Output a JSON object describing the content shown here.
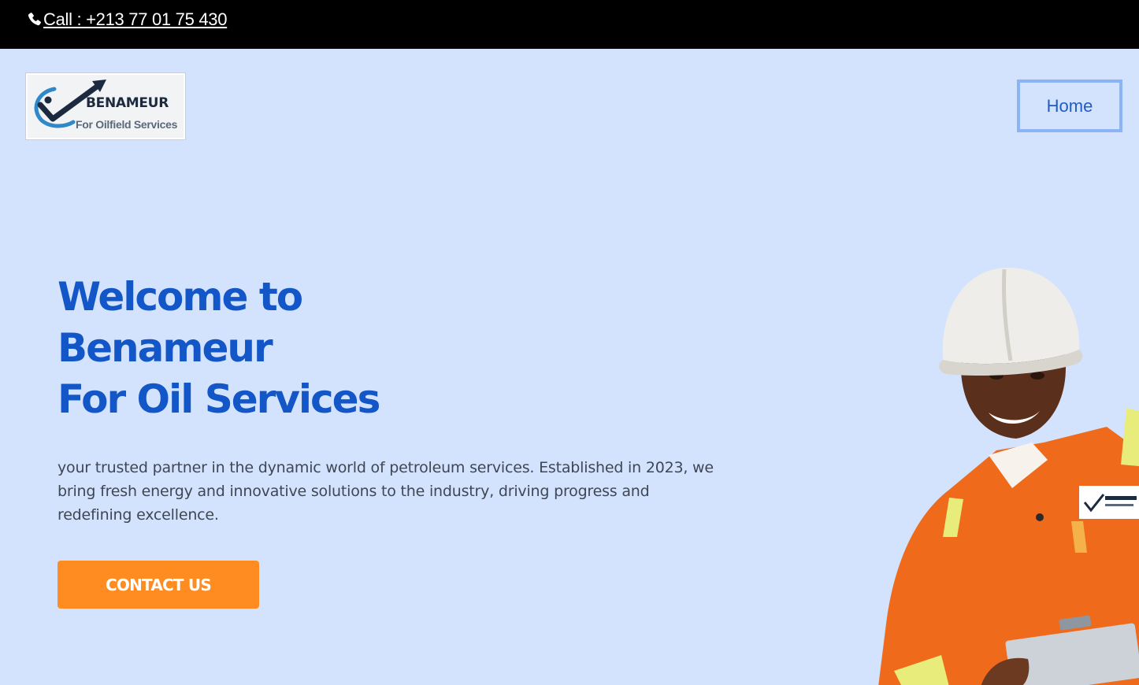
{
  "topbar": {
    "call_label": "Call : +213 77 01 75 430",
    "phone_icon": "phone-icon"
  },
  "logo": {
    "title": "BENAMEUR",
    "subtitle": "For Oilfield Services"
  },
  "nav": {
    "home_label": "Home"
  },
  "hero": {
    "headline": [
      "Welcome to",
      "Benameur",
      "For Oil Services"
    ],
    "intro": "your trusted partner in the dynamic world of petroleum services. Established in 2023, we bring fresh energy and innovative solutions to the industry, driving progress and redefining excellence.",
    "cta_label": "CONTACT US",
    "image_alt": "Oilfield worker in orange coverall and white hard hat holding a clipboard"
  },
  "colors": {
    "topbar_bg": "#000000",
    "hero_bg": "#d3e3fd",
    "headline": "#1256c8",
    "cta_bg": "#ff8c20",
    "home_border": "#8cb4f4",
    "body_text": "#3f4654"
  }
}
